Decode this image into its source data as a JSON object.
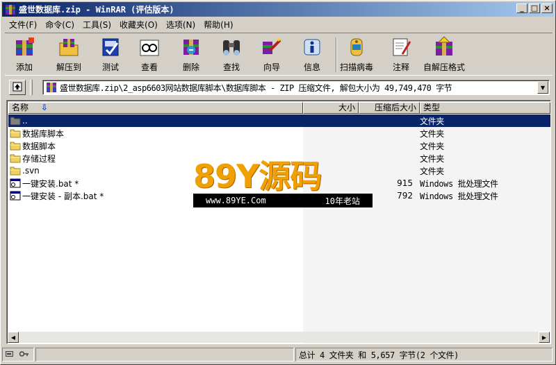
{
  "window": {
    "title": "盛世数据库.zip - WinRAR (评估版本)",
    "min_label": "_",
    "max_label": "□",
    "close_label": "×"
  },
  "menu": [
    "文件(F)",
    "命令(C)",
    "工具(S)",
    "收藏夹(O)",
    "选项(N)",
    "帮助(H)"
  ],
  "toolbar": [
    {
      "label": "添加",
      "icon": "add-icon"
    },
    {
      "label": "解压到",
      "icon": "extract-icon"
    },
    {
      "label": "测试",
      "icon": "test-icon"
    },
    {
      "label": "查看",
      "icon": "view-icon"
    },
    {
      "label": "删除",
      "icon": "delete-icon"
    },
    {
      "label": "查找",
      "icon": "find-icon"
    },
    {
      "label": "向导",
      "icon": "wizard-icon"
    },
    {
      "label": "信息",
      "icon": "info-icon"
    },
    {
      "label": "扫描病毒",
      "icon": "virus-scan-icon"
    },
    {
      "label": "注释",
      "icon": "comment-icon"
    },
    {
      "label": "自解压格式",
      "icon": "sfx-icon"
    }
  ],
  "address": {
    "path": "盛世数据库.zip\\2_asp6603网站数据库脚本\\数据库脚本 - ZIP 压缩文件, 解包大小为 49,749,470 字节"
  },
  "columns": {
    "name": "名称",
    "size": "大小",
    "packed": "压缩后大小",
    "type": "类型"
  },
  "files": [
    {
      "name": "..",
      "size": "",
      "packed": "",
      "type": "文件夹",
      "icon": "parent-folder-icon",
      "selected": true
    },
    {
      "name": "数据库脚本",
      "size": "",
      "packed": "",
      "type": "文件夹",
      "icon": "folder-icon",
      "selected": false
    },
    {
      "name": "数据脚本",
      "size": "",
      "packed": "",
      "type": "文件夹",
      "icon": "folder-icon",
      "selected": false
    },
    {
      "name": "存储过程",
      "size": "",
      "packed": "",
      "type": "文件夹",
      "icon": "folder-icon",
      "selected": false
    },
    {
      "name": ".svn",
      "size": "",
      "packed": "",
      "type": "文件夹",
      "icon": "folder-icon",
      "selected": false
    },
    {
      "name": "一键安装.bat *",
      "size": "",
      "packed": "915",
      "type": "Windows 批处理文件",
      "icon": "batch-file-icon",
      "selected": false
    },
    {
      "name": "一键安装 - 副本.bat *",
      "size": "",
      "packed": "792",
      "type": "Windows 批处理文件",
      "icon": "batch-file-icon",
      "selected": false
    }
  ],
  "watermark": {
    "brand": "89Y源码",
    "url": "www.89YE.Com",
    "slogan": "10年老站"
  },
  "status": {
    "summary": "总计 4 文件夹 和 5,657 字节(2 个文件)"
  },
  "colors": {
    "selection": "#0a246a",
    "title_gradient_start": "#0a246a",
    "title_gradient_end": "#a6caf0",
    "watermark": "#f0a000"
  }
}
